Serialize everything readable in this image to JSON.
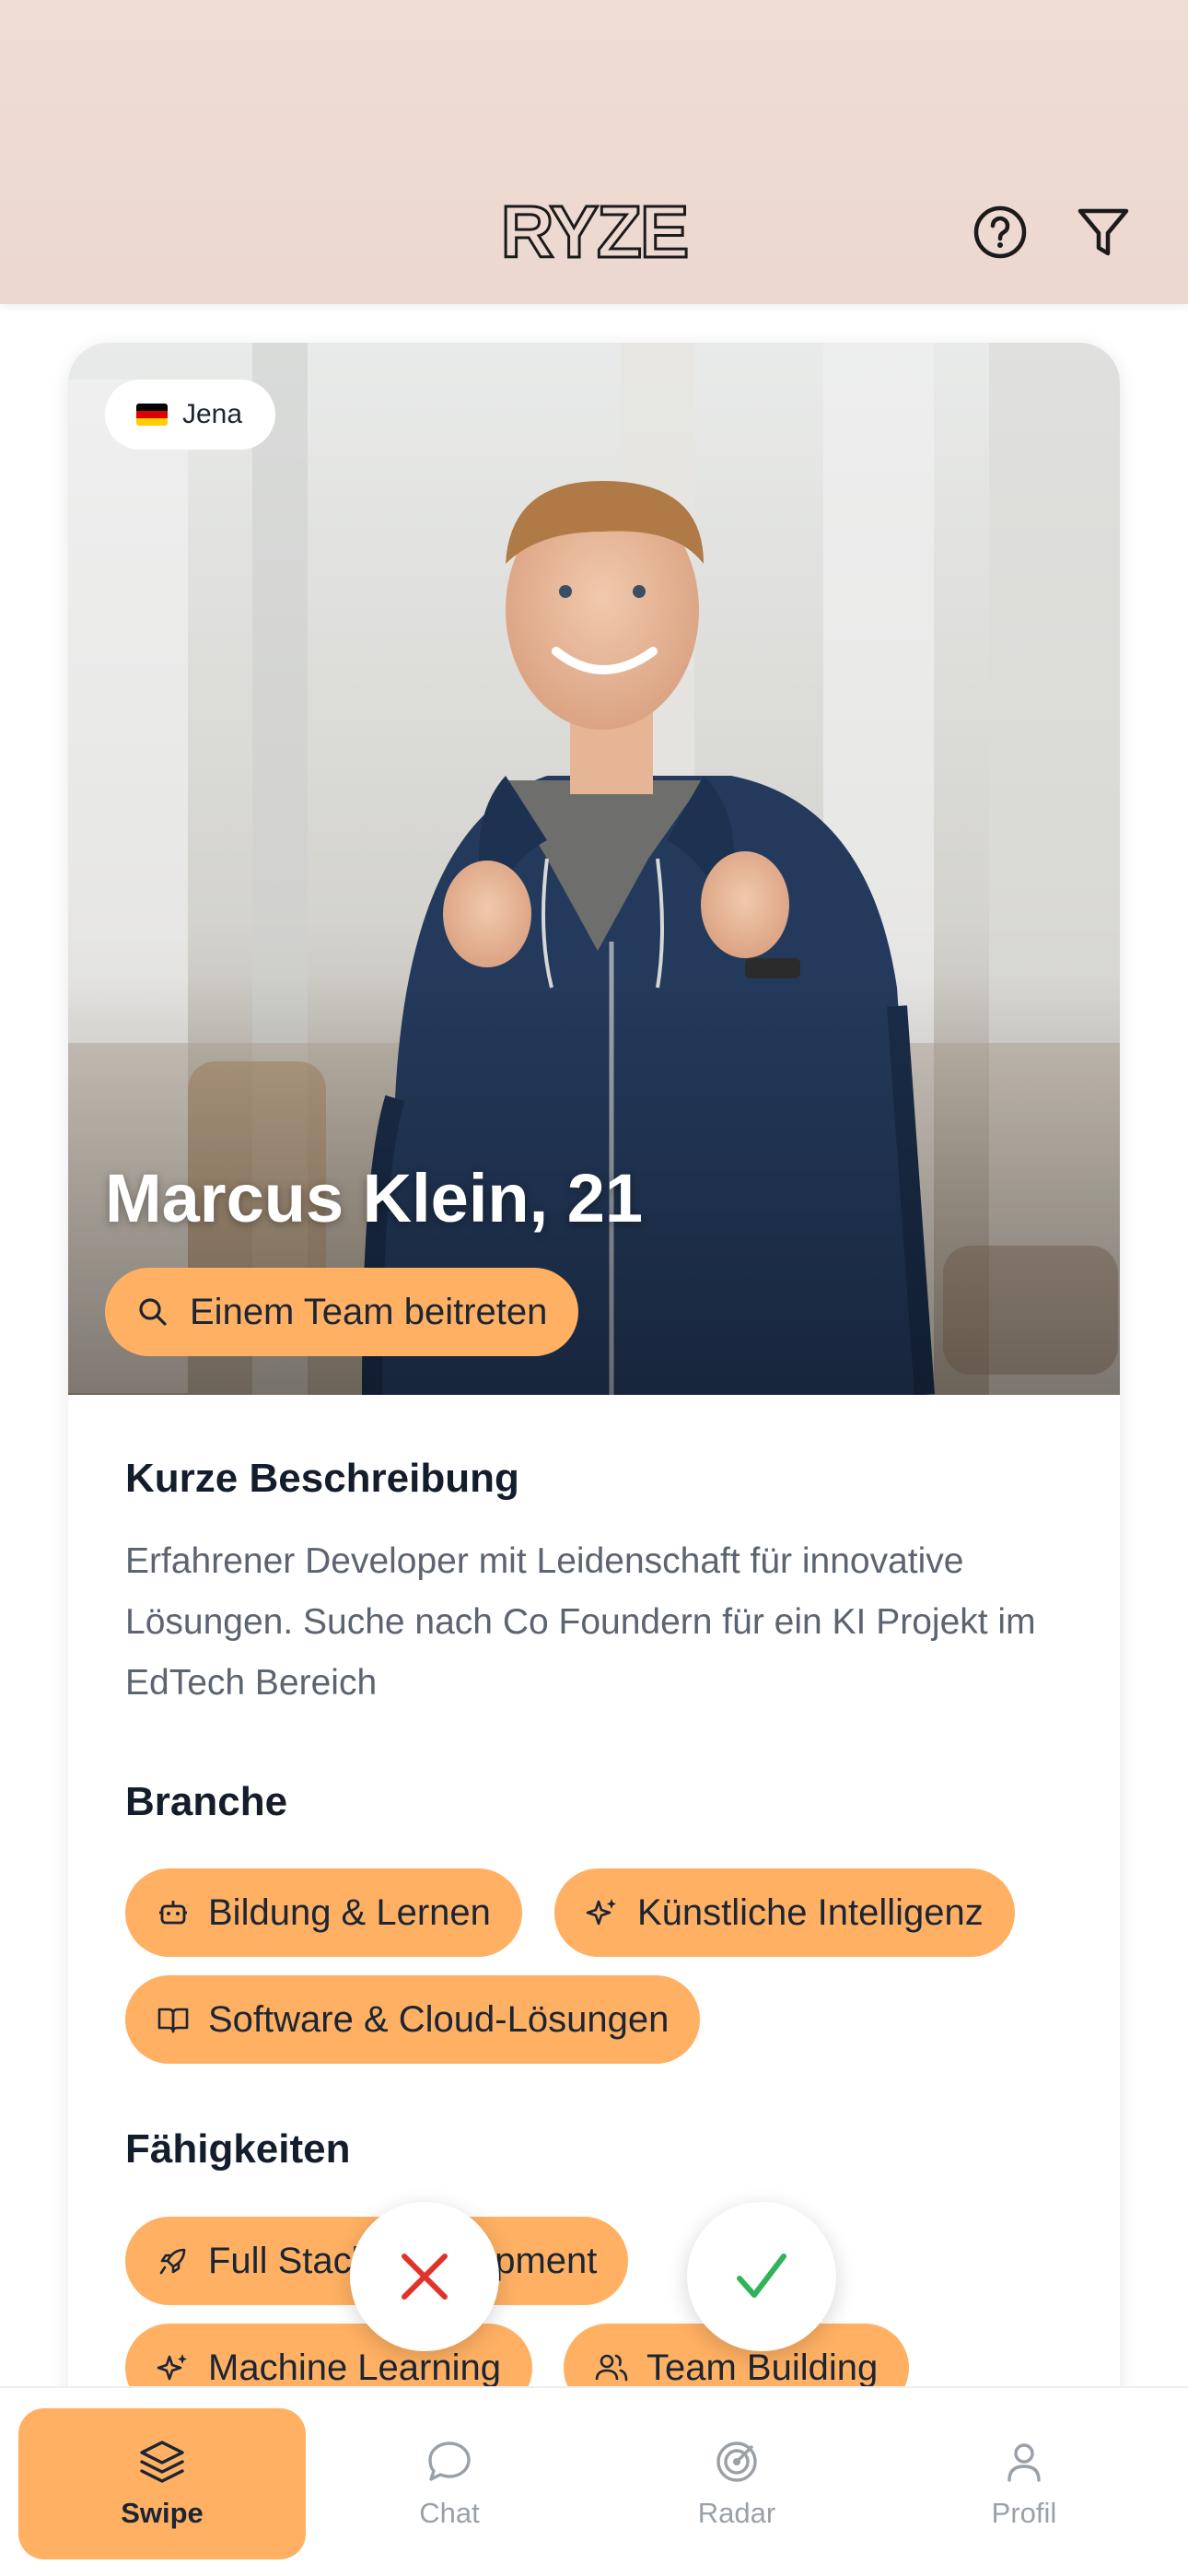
{
  "header": {
    "logo_text": "RYZE",
    "icons": [
      "help-icon",
      "filter-icon"
    ]
  },
  "profile": {
    "location": "Jena",
    "flag": [
      "#000000",
      "#dd0000",
      "#ffce00"
    ],
    "name": "Marcus Klein, 21",
    "team_action": "Einem Team beitreten",
    "sections": {
      "description_title": "Kurze Beschreibung",
      "description": "Erfahrener Developer mit Leidenschaft für innovative Lösungen. Suche nach Co Foundern für ein KI Projekt im EdTech Bereich",
      "industry_title": "Branche",
      "industries": [
        {
          "label": "Bildung & Lernen",
          "icon": "robot-icon"
        },
        {
          "label": "Künstliche Intelligenz",
          "icon": "sparkles-icon"
        },
        {
          "label": "Software & Cloud-Lösungen",
          "icon": "book-open-icon"
        }
      ],
      "skills_title": "Fähigkeiten",
      "skills": [
        {
          "label": "Full Stack Development",
          "icon": "rocket-icon"
        },
        {
          "label": "Machine Learning",
          "icon": "sparkles-icon"
        },
        {
          "label": "Team Building",
          "icon": "users-icon"
        }
      ]
    }
  },
  "actions": {
    "reject_icon": "close-icon",
    "accept_icon": "check-icon"
  },
  "nav": {
    "items": [
      {
        "label": "Swipe",
        "icon": "layers-icon",
        "active": true
      },
      {
        "label": "Chat",
        "icon": "chat-bubble-icon",
        "active": false
      },
      {
        "label": "Radar",
        "icon": "radar-icon",
        "active": false
      },
      {
        "label": "Profil",
        "icon": "user-icon",
        "active": false
      }
    ]
  },
  "colors": {
    "accent": "#ffb063",
    "header_bg": "#efdcd3",
    "reject": "#e0342b",
    "accept": "#2fb45a",
    "text_dark": "#1b2533",
    "text_muted": "#5b6470",
    "nav_inactive": "#9aa0a8"
  }
}
